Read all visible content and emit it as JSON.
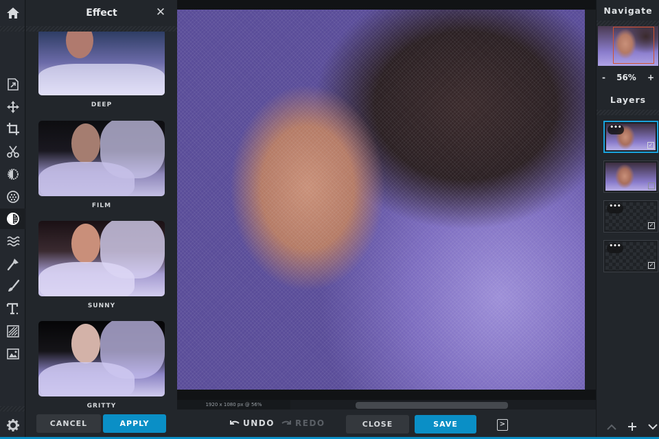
{
  "toolbar": {
    "items": [
      {
        "name": "home",
        "icon": "home-icon"
      },
      {
        "name": "resize",
        "icon": "resize-icon"
      },
      {
        "name": "move",
        "icon": "move-icon"
      },
      {
        "name": "crop",
        "icon": "crop-icon"
      },
      {
        "name": "cut",
        "icon": "scissors-icon"
      },
      {
        "name": "adjust",
        "icon": "adjust-icon"
      },
      {
        "name": "filter",
        "icon": "filter-icon"
      },
      {
        "name": "effect",
        "icon": "effect-icon",
        "active": true
      },
      {
        "name": "liquify",
        "icon": "wave-icon"
      },
      {
        "name": "retouch",
        "icon": "retouch-brush-icon"
      },
      {
        "name": "draw",
        "icon": "paint-brush-icon"
      },
      {
        "name": "text",
        "icon": "text-icon"
      },
      {
        "name": "overlay",
        "icon": "stripes-icon"
      },
      {
        "name": "add-image",
        "icon": "image-icon"
      },
      {
        "name": "settings",
        "icon": "gear-icon"
      }
    ]
  },
  "effect_panel": {
    "title": "Effect",
    "close_icon": "close-icon",
    "effects": [
      {
        "label": "DEEP"
      },
      {
        "label": "FILM"
      },
      {
        "label": "SUNNY"
      },
      {
        "label": "GRITTY"
      }
    ],
    "cancel_label": "CANCEL",
    "apply_label": "APPLY"
  },
  "canvas": {
    "status": "1920 x 1080 px @ 56%"
  },
  "bottom_bar": {
    "undo_label": "UNDO",
    "redo_label": "REDO",
    "close_label": "CLOSE",
    "save_label": "SAVE"
  },
  "right_panel": {
    "navigate_title": "Navigate",
    "zoom_minus": "-",
    "zoom_value": "56%",
    "zoom_plus": "+",
    "layers_title": "Layers",
    "layers": [
      {
        "type": "image",
        "visible": true,
        "selected": true
      },
      {
        "type": "image",
        "visible": false,
        "selected": false
      },
      {
        "type": "empty",
        "visible": true,
        "selected": false
      },
      {
        "type": "empty",
        "visible": true,
        "selected": false
      }
    ],
    "layer_menu_glyph": "•••",
    "check_glyph": "✓",
    "actions": {
      "up": "^",
      "add": "+",
      "down": "v"
    }
  },
  "colors": {
    "accent": "#0a8fc6",
    "selection": "#1aa3dd",
    "nav_viewport": "#d2522f",
    "panel_bg": "#22262b"
  }
}
